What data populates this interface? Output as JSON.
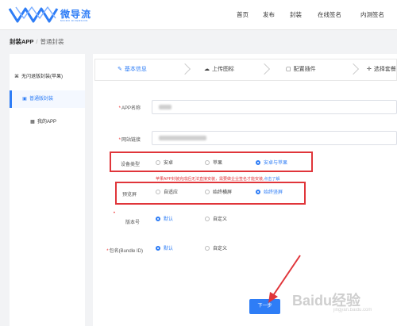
{
  "brand": {
    "name": "微导流",
    "sub": "MICRO DIVERSION"
  },
  "nav": [
    "首页",
    "发布",
    "封装",
    "在线签名",
    "内测签名"
  ],
  "breadcrumb": {
    "root": "封装APP",
    "current": "普通封装"
  },
  "sidebar": {
    "items": [
      {
        "label": "无闪退版封装(苹果)"
      },
      {
        "label": "普通版封装"
      },
      {
        "label": "我的APP"
      }
    ]
  },
  "steps": [
    {
      "label": "基本信息",
      "icon": "edit-icon"
    },
    {
      "label": "上传图标",
      "icon": "upload-icon"
    },
    {
      "label": "配置插件",
      "icon": "plugin-icon"
    },
    {
      "label": "选择套餐",
      "icon": "plus-icon"
    }
  ],
  "form": {
    "app_name_label": "APP名称",
    "url_label": "网站链接",
    "device_label": "设备类型",
    "device_options": [
      "安卓",
      "苹果",
      "安卓与苹果"
    ],
    "device_selected": "安卓与苹果",
    "warning_text": "苹果APP封装完成后无法直接安装，需要做企业签名才能安装,",
    "warning_link": "点击了解",
    "splash_label": "预览屏",
    "splash_options": [
      "自适应",
      "始终横屏",
      "始终竖屏"
    ],
    "splash_selected": "始终竖屏",
    "version_label": "版本号",
    "version_options": [
      "默认",
      "自定义"
    ],
    "version_selected": "默认",
    "bundle_label": "包名(Bundle ID)",
    "bundle_options": [
      "默认",
      "自定义"
    ],
    "bundle_selected": "默认",
    "next_button": "下一步"
  },
  "watermark": {
    "text": "Baidu经验",
    "sub": "jingyan.baidu.com"
  },
  "colors": {
    "accent": "#2e7df6",
    "annotation": "#e0353a"
  }
}
